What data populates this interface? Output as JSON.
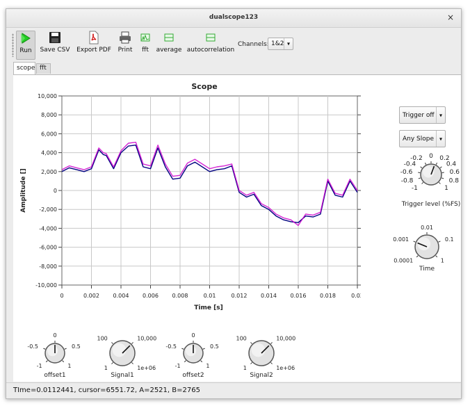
{
  "window": {
    "title": "dualscope123",
    "close_glyph": "×"
  },
  "toolbar": {
    "buttons": [
      {
        "label": "Run",
        "icon": "play-icon"
      },
      {
        "label": "Save CSV",
        "icon": "floppy-disk-icon"
      },
      {
        "label": "Export PDF",
        "icon": "pdf-icon"
      },
      {
        "label": "Print",
        "icon": "printer-icon"
      },
      {
        "label": "fft",
        "icon": "spectrum-icon"
      },
      {
        "label": "average",
        "icon": "average-icon"
      },
      {
        "label": "autocorrelation",
        "icon": "autocorrelation-icon"
      }
    ],
    "channels_label": "Channels:",
    "channels_value": "1&2",
    "dropdown_arrow": "▾"
  },
  "tabs": [
    {
      "label": "scope",
      "active": true
    },
    {
      "label": "fft",
      "active": false
    }
  ],
  "trigger": {
    "mode": "Trigger off",
    "slope": "Any Slope",
    "level_label": "Trigger level (%FS)",
    "level_ticks": [
      "-1",
      "-0.8",
      "-0.6",
      "-0.4",
      "-0.2",
      "0",
      "0.2",
      "0.4",
      "0.6",
      "0.8",
      "1"
    ],
    "level_value": 0.15
  },
  "time_knob": {
    "label": "Time",
    "ticks": [
      "0.0001",
      "0.001",
      "0.01",
      "0.1",
      "1"
    ],
    "value": 0.001
  },
  "bottom_knobs": [
    {
      "label": "offset1",
      "ticks": [
        "-1",
        "-0.5",
        "0",
        "0.5",
        "1"
      ],
      "value": 0
    },
    {
      "label": "Signal1",
      "ticks": [
        "1",
        "100",
        "10,000",
        "1e+06"
      ],
      "value": 10000
    },
    {
      "label": "offset2",
      "ticks": [
        "-1",
        "-0.5",
        "0",
        "0.5",
        "1"
      ],
      "value": 0
    },
    {
      "label": "Signal2",
      "ticks": [
        "1",
        "100",
        "10,000",
        "1e+06"
      ],
      "value": 10000
    }
  ],
  "status": {
    "text": "TIme=0.0112441, cursor=6551.72, A=2521, B=2765"
  },
  "colors": {
    "series_a": "#000080",
    "series_b": "#cc00cc",
    "grid": "#c8c8c8",
    "run_icon": "#22cc22"
  },
  "chart_data": {
    "type": "line",
    "title": "Scope",
    "xlabel": "Time [s]",
    "ylabel": "Amplitude []",
    "xlim": [
      0,
      0.02
    ],
    "ylim": [
      -10000,
      10000
    ],
    "x_ticks": [
      "0",
      "0.002",
      "0.004",
      "0.006",
      "0.008",
      "0.01",
      "0.012",
      "0.014",
      "0.016",
      "0.018",
      "0.02"
    ],
    "y_ticks": [
      "-10,000",
      "-8,000",
      "-6,000",
      "-4,000",
      "-2,000",
      "0",
      "2,000",
      "4,000",
      "6,000",
      "8,000",
      "10,000"
    ],
    "grid": true,
    "x": [
      0,
      0.0005,
      0.001,
      0.0015,
      0.002,
      0.0025,
      0.0028,
      0.003,
      0.0035,
      0.004,
      0.0045,
      0.005,
      0.0055,
      0.006,
      0.0065,
      0.007,
      0.0075,
      0.008,
      0.0085,
      0.009,
      0.0095,
      0.01,
      0.0105,
      0.011,
      0.0115,
      0.012,
      0.0125,
      0.013,
      0.0135,
      0.014,
      0.0145,
      0.015,
      0.0155,
      0.016,
      0.0165,
      0.017,
      0.0175,
      0.018,
      0.0185,
      0.019,
      0.0195,
      0.02
    ],
    "series": [
      {
        "values": [
          2000,
          2400,
          2200,
          2000,
          2300,
          4300,
          3800,
          3700,
          2300,
          4000,
          4700,
          4800,
          2500,
          2300,
          4500,
          2500,
          1200,
          1300,
          2600,
          3000,
          2500,
          2000,
          2200,
          2300,
          2600,
          -200,
          -700,
          -400,
          -1600,
          -2000,
          -2700,
          -3100,
          -3300,
          -3400,
          -2700,
          -2800,
          -2500,
          1000,
          -500,
          -700,
          1000,
          -200
        ]
      },
      {
        "values": [
          2200,
          2600,
          2400,
          2200,
          2500,
          4500,
          4000,
          3900,
          2500,
          4200,
          5000,
          5100,
          2800,
          2600,
          4800,
          2800,
          1500,
          1600,
          2900,
          3300,
          2800,
          2300,
          2500,
          2600,
          2800,
          0,
          -500,
          -200,
          -1400,
          -1800,
          -2500,
          -2900,
          -3100,
          -3700,
          -2500,
          -2600,
          -2300,
          1200,
          -300,
          -500,
          1200,
          0
        ]
      }
    ]
  }
}
